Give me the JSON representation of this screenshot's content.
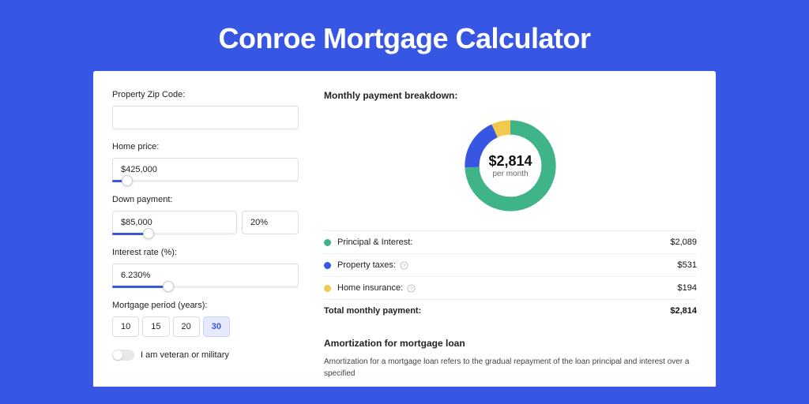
{
  "colors": {
    "bg": "#3756e4",
    "principal": "#3fb489",
    "taxes": "#3756e4",
    "insurance": "#f2c94c"
  },
  "title": "Conroe Mortgage Calculator",
  "form": {
    "zip": {
      "label": "Property Zip Code:",
      "value": ""
    },
    "home_price": {
      "label": "Home price:",
      "value": "$425,000",
      "slider_pct": 8
    },
    "down_payment": {
      "label": "Down payment:",
      "amount": "$85,000",
      "percent": "20%",
      "slider_pct": 20
    },
    "interest_rate": {
      "label": "Interest rate (%):",
      "value": "6.230%",
      "slider_pct": 30
    },
    "period": {
      "label": "Mortgage period (years):",
      "options": [
        "10",
        "15",
        "20",
        "30"
      ],
      "selected": "30"
    },
    "veteran": {
      "label": "I am veteran or military",
      "value": false
    }
  },
  "breakdown": {
    "title": "Monthly payment breakdown:",
    "donut": {
      "amount": "$2,814",
      "sub": "per month"
    },
    "items": [
      {
        "key": "principal",
        "label": "Principal & Interest:",
        "value": "$2,089",
        "color": "#3fb489",
        "info": false
      },
      {
        "key": "taxes",
        "label": "Property taxes:",
        "value": "$531",
        "color": "#3756e4",
        "info": true
      },
      {
        "key": "insurance",
        "label": "Home insurance:",
        "value": "$194",
        "color": "#f2c94c",
        "info": true
      }
    ],
    "total": {
      "label": "Total monthly payment:",
      "value": "$2,814"
    }
  },
  "amortization": {
    "title": "Amortization for mortgage loan",
    "body": "Amortization for a mortgage loan refers to the gradual repayment of the loan principal and interest over a specified"
  },
  "chart_data": {
    "type": "pie",
    "title": "Monthly payment breakdown",
    "categories": [
      "Principal & Interest",
      "Property taxes",
      "Home insurance"
    ],
    "values": [
      2089,
      531,
      194
    ],
    "colors": [
      "#3fb489",
      "#3756e4",
      "#f2c94c"
    ],
    "total": 2814,
    "center_label": "$2,814 per month"
  }
}
